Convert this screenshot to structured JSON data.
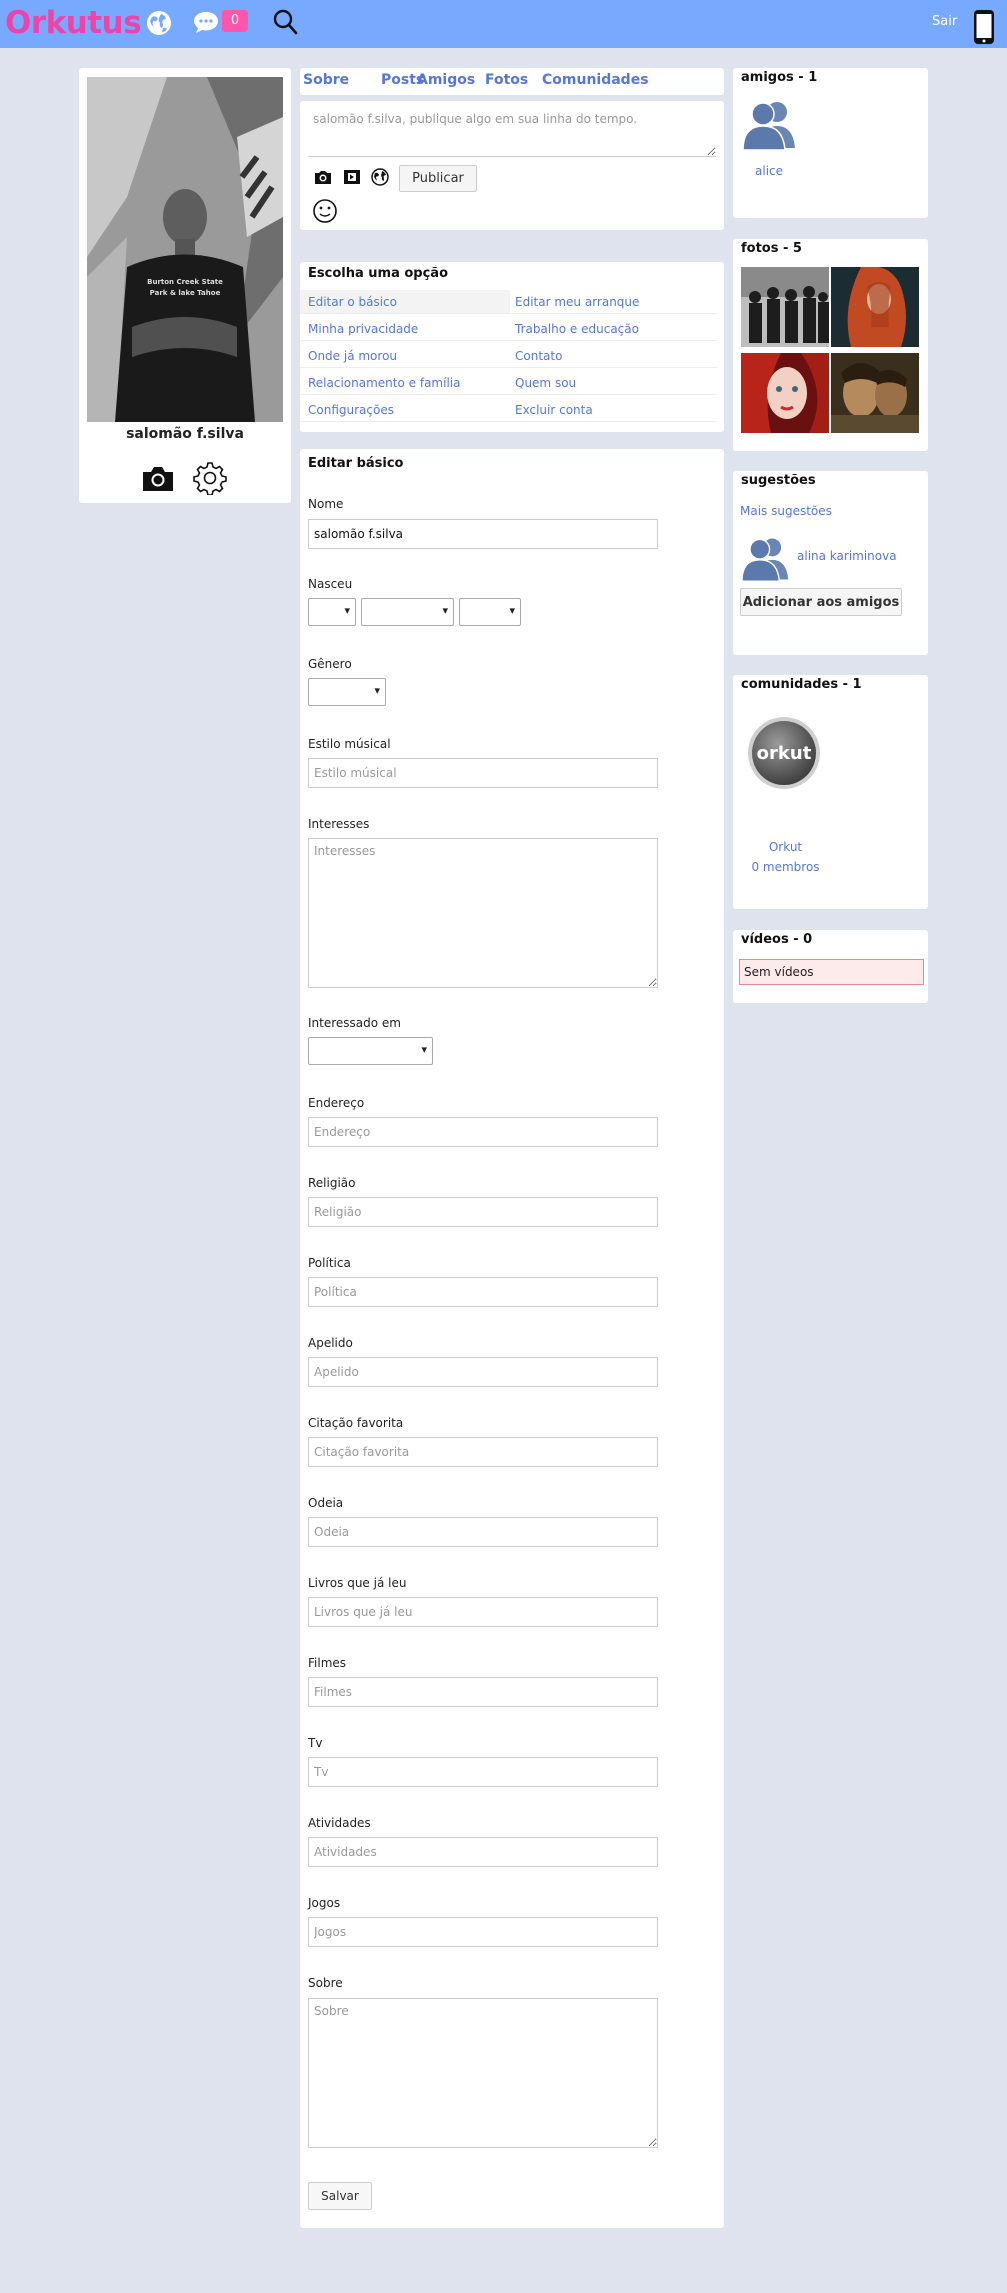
{
  "header": {
    "logo": "Orkutus",
    "message_count": "0",
    "logout_label": "Sair"
  },
  "profile": {
    "name": "salomão f.silva",
    "shirt_text_1": "Burton Creek State",
    "shirt_text_2": "Park & lake Tahoe"
  },
  "tabs": [
    "Sobre",
    "Posts",
    "Amigos",
    "Fotos",
    "Comunidades"
  ],
  "post": {
    "placeholder": "salomão f.silva, publique algo em sua linha do tempo.",
    "publish_label": "Publicar"
  },
  "options": {
    "title": "Escolha uma opção",
    "items": [
      "Editar o básico",
      "Editar meu arranque",
      "Minha privacidade",
      "Trabalho e educação",
      "Onde já morou",
      "Contato",
      "Relacionamento e família",
      "Quem sou",
      "Configurações",
      "Excluir conta"
    ]
  },
  "form": {
    "title": "Editar básico",
    "nome_label": "Nome",
    "nome_value": "salomão f.silva",
    "nasceu_label": "Nasceu",
    "genero_label": "Gênero",
    "estilo_label": "Estilo músical",
    "estilo_placeholder": "Estilo músical",
    "interesses_label": "Interesses",
    "interesses_placeholder": "Interesses",
    "interessado_label": "Interessado em",
    "endereco_label": "Endereço",
    "endereco_placeholder": "Endereço",
    "religiao_label": "Religião",
    "religiao_placeholder": "Religião",
    "politica_label": "Política",
    "politica_placeholder": "Política",
    "apelido_label": "Apelido",
    "apelido_placeholder": "Apelido",
    "citacao_label": "Citação favorita",
    "citacao_placeholder": "Citação favorita",
    "odeia_label": "Odeia",
    "odeia_placeholder": "Odeia",
    "livros_label": "Livros que já leu",
    "livros_placeholder": "Livros que já leu",
    "filmes_label": "Filmes",
    "filmes_placeholder": "Filmes",
    "tv_label": "Tv",
    "tv_placeholder": "Tv",
    "atividades_label": "Atividades",
    "atividades_placeholder": "Atividades",
    "jogos_label": "Jogos",
    "jogos_placeholder": "Jogos",
    "sobre_label": "Sobre",
    "sobre_placeholder": "Sobre",
    "save_label": "Salvar"
  },
  "friends": {
    "title": "amigos - 1",
    "items": [
      {
        "name": "alice"
      }
    ]
  },
  "photos": {
    "title": "fotos - 5"
  },
  "suggestions": {
    "title": "sugestões",
    "more_label": "Mais sugestões",
    "person_name": "alina kariminova",
    "add_label": "Adicionar aos amigos"
  },
  "communities": {
    "title": "comunidades - 1",
    "logo_text": "orkut",
    "name": "Orkut",
    "members": "0 membros"
  },
  "videos": {
    "title": "vídeos - 0",
    "empty_label": "Sem vídeos"
  },
  "colors": {
    "header_bg": "#77aaff",
    "logo": "#ee44aa",
    "link": "#5577dd",
    "badge": "#ff55aa",
    "page_bg": "#dfe3ee"
  }
}
